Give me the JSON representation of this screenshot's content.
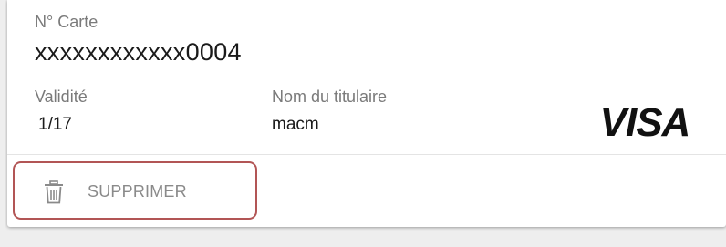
{
  "card": {
    "number_label": "N° Carte",
    "number_value": "xxxxxxxxxxxx0004",
    "validity_label": "Validité",
    "validity_value": "1/17",
    "holder_label": "Nom du titulaire",
    "holder_value": "macm",
    "brand": "VISA",
    "brand_icon": "visa-logo",
    "brand_color": "#111111"
  },
  "actions": {
    "delete_label": "SUPPRIMER",
    "delete_icon": "trash-icon",
    "highlight_color": "#b25555"
  }
}
